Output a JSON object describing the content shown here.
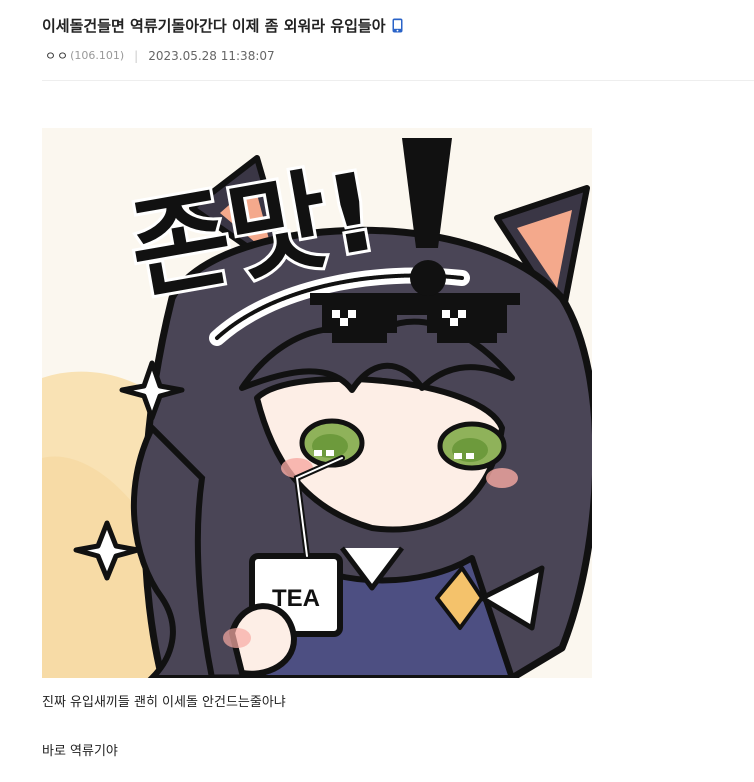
{
  "post": {
    "title": "이세돌건들면 역류기돌아간다 이제 좀 외워라 유입들아",
    "author": "ㅇㅇ",
    "ip": "(106.101)",
    "separator": "|",
    "date": "2023.05.28 11:38:07",
    "title_icon": "mobile-phone-icon",
    "image": {
      "sticker_caption_text": "존맛!",
      "carton_text": "TEA"
    },
    "body_lines": [
      "진짜 유입새끼들 괜히 이세돌 안건드는줄아냐",
      "바로 역류기야"
    ]
  },
  "colors": {
    "title": "#222222",
    "ip": "#999999",
    "date": "#666666",
    "mobile_icon": "#2a63c8",
    "divider": "#eeeeee"
  }
}
